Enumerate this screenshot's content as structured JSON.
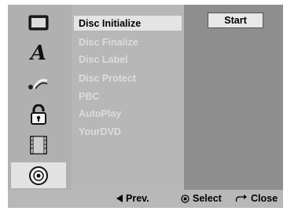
{
  "sidebar": {
    "items": [
      {
        "icon": "monitor-icon"
      },
      {
        "icon": "language-icon",
        "glyph": "A"
      },
      {
        "icon": "audio-icon"
      },
      {
        "icon": "lock-icon"
      },
      {
        "icon": "film-icon"
      },
      {
        "icon": "disc-icon",
        "selected": true
      }
    ]
  },
  "menu": {
    "items": [
      {
        "label": "Disc Initialize",
        "selected": true
      },
      {
        "label": "Disc Finalize"
      },
      {
        "label": "Disc Label"
      },
      {
        "label": "Disc Protect"
      },
      {
        "label": "PBC"
      },
      {
        "label": "AutoPlay"
      },
      {
        "label": "YourDVD"
      }
    ]
  },
  "action": {
    "start_label": "Start"
  },
  "footer": {
    "prev_label": "Prev.",
    "select_label": "Select",
    "close_label": "Close"
  }
}
